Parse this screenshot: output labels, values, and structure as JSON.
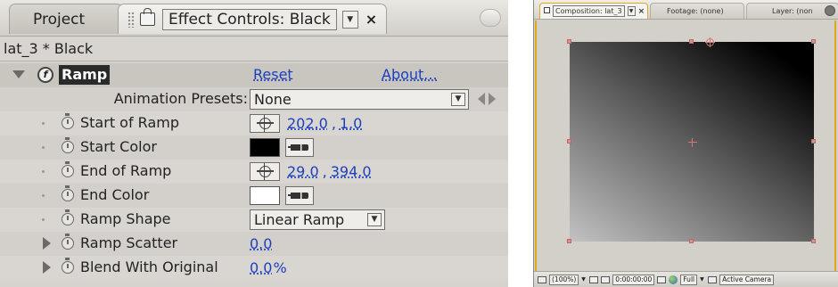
{
  "effect_controls": {
    "tabs": {
      "project_label": "Project",
      "effect_label": "Effect Controls: Black",
      "close_glyph": "×",
      "dropdown_glyph": "▼"
    },
    "layer_title": "lat_3 * Black",
    "effect": {
      "name": "Ramp",
      "reset_label": "Reset",
      "about_label": "About...",
      "presets_label": "Animation Presets:",
      "presets_value": "None",
      "properties": [
        {
          "label": "Start of Ramp",
          "type": "point",
          "x": "202.0",
          "y": "1.0"
        },
        {
          "label": "Start Color",
          "type": "color",
          "color": "#000000"
        },
        {
          "label": "End of Ramp",
          "type": "point",
          "x": "29.0",
          "y": "394.0"
        },
        {
          "label": "End Color",
          "type": "color",
          "color": "#ffffff"
        },
        {
          "label": "Ramp Shape",
          "type": "select",
          "value": "Linear Ramp"
        },
        {
          "label": "Ramp Scatter",
          "type": "number",
          "value": "0.0"
        },
        {
          "label": "Blend With Original",
          "type": "percent",
          "value": "0.0",
          "unit": "%"
        }
      ]
    }
  },
  "composition": {
    "tabs": {
      "comp_label": "Composition: lat_3",
      "footage_label": "Footage: (none)",
      "layer_label": "Layer: (non"
    },
    "footer": {
      "zoom": "(100%)",
      "timecode": "0:00:00:00",
      "resolution": "Full",
      "camera": "Active Camera"
    },
    "accent_color": "#e0a81a",
    "icons": [
      "lock-icon",
      "crosshair-icon",
      "stopwatch-icon",
      "eyedropper-icon",
      "anchor-icon",
      "globe-icon"
    ]
  }
}
